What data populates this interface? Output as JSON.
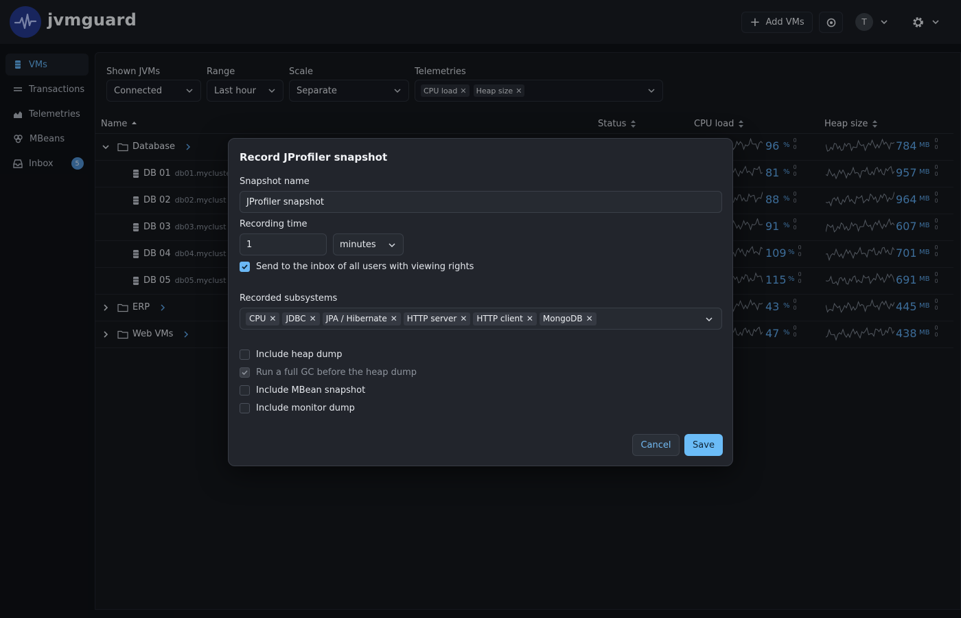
{
  "header": {
    "app_title": "jvmguard",
    "add_vms_label": "Add VMs",
    "avatar_initial": "T"
  },
  "sidebar": {
    "items": [
      {
        "label": "VMs",
        "icon": "database-icon",
        "active": true
      },
      {
        "label": "Transactions",
        "icon": "transactions-icon"
      },
      {
        "label": "Telemetries",
        "icon": "chart-icon"
      },
      {
        "label": "MBeans",
        "icon": "mbeans-icon"
      },
      {
        "label": "Inbox",
        "icon": "inbox-icon",
        "badge": "5"
      }
    ]
  },
  "filters": {
    "shown_jvms": {
      "label": "Shown JVMs",
      "value": "Connected"
    },
    "range": {
      "label": "Range",
      "value": "Last hour"
    },
    "scale": {
      "label": "Scale",
      "value": "Separate"
    },
    "telemetries": {
      "label": "Telemetries",
      "chips": [
        "CPU load",
        "Heap size"
      ]
    }
  },
  "table": {
    "columns": {
      "name": "Name",
      "status": "Status",
      "cpu": "CPU load",
      "heap": "Heap size"
    },
    "rows": [
      {
        "type": "group",
        "name": "Database",
        "expanded": true,
        "cpu": "96",
        "cpu_unit": "%",
        "heap": "784",
        "heap_unit": "MB"
      },
      {
        "type": "vm",
        "name": "DB 01",
        "host": "db01.mycluster.",
        "cpu": "81",
        "cpu_unit": "%",
        "heap": "957",
        "heap_unit": "MB"
      },
      {
        "type": "vm",
        "name": "DB 02",
        "host": "db02.myclust",
        "cpu": "88",
        "cpu_unit": "%",
        "heap": "964",
        "heap_unit": "MB"
      },
      {
        "type": "vm",
        "name": "DB 03",
        "host": "db03.myclust",
        "cpu": "91",
        "cpu_unit": "%",
        "heap": "607",
        "heap_unit": "MB"
      },
      {
        "type": "vm",
        "name": "DB 04",
        "host": "db04.myclust",
        "cpu": "109",
        "cpu_unit": "%",
        "heap": "701",
        "heap_unit": "MB"
      },
      {
        "type": "vm",
        "name": "DB 05",
        "host": "db05.myclust",
        "cpu": "115",
        "cpu_unit": "%",
        "heap": "691",
        "heap_unit": "MB"
      },
      {
        "type": "group",
        "name": "ERP",
        "expanded": false,
        "cpu": "43",
        "cpu_unit": "%",
        "heap": "445",
        "heap_unit": "MB"
      },
      {
        "type": "group",
        "name": "Web VMs",
        "expanded": false,
        "cpu": "47",
        "cpu_unit": "%",
        "heap": "438",
        "heap_unit": "MB"
      }
    ],
    "mini_value": "0"
  },
  "dialog": {
    "title": "Record JProfiler snapshot",
    "snapshot_name_label": "Snapshot name",
    "snapshot_name_value": "JProfiler snapshot",
    "recording_time_label": "Recording time",
    "recording_time_value": "1",
    "recording_time_unit": "minutes",
    "send_inbox_label": "Send to the inbox of all users with viewing rights",
    "send_inbox_checked": true,
    "recorded_subsystems_label": "Recorded subsystems",
    "subsystems": [
      "CPU",
      "JDBC",
      "JPA / Hibernate",
      "HTTP server",
      "HTTP client",
      "MongoDB"
    ],
    "options": [
      {
        "label": "Include heap dump",
        "checked": false,
        "disabled": false
      },
      {
        "label": "Run a full GC before the heap dump",
        "checked": true,
        "disabled": true
      },
      {
        "label": "Include MBean snapshot",
        "checked": false,
        "disabled": false
      },
      {
        "label": "Include monitor dump",
        "checked": false,
        "disabled": false
      }
    ],
    "cancel_label": "Cancel",
    "save_label": "Save"
  },
  "colors": {
    "accent": "#63b3f5",
    "save_button": "#6bbcf7",
    "logo_bg": "#253a8f",
    "value_blue": "#5da7ea"
  }
}
